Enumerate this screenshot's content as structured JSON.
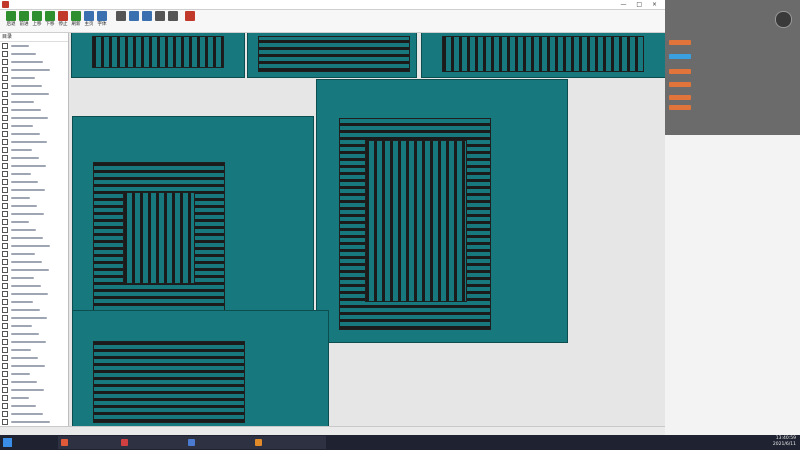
{
  "window": {
    "title": "",
    "controls": [
      "—",
      "□",
      "×"
    ]
  },
  "toolbar": {
    "buttons": [
      {
        "label": "后退",
        "icon": "back-arrow-icon",
        "color": "#2f8f2f"
      },
      {
        "label": "前进",
        "icon": "forward-arrow-icon",
        "color": "#2f8f2f"
      },
      {
        "label": "上移",
        "icon": "up-arrow-icon",
        "color": "#2f8f2f"
      },
      {
        "label": "下移",
        "icon": "down-arrow-icon",
        "color": "#2f8f2f"
      },
      {
        "label": "停止",
        "icon": "stop-icon",
        "color": "#c0392b"
      },
      {
        "label": "刷新",
        "icon": "refresh-icon",
        "color": "#2f8f2f"
      },
      {
        "label": "主页",
        "icon": "home-icon",
        "color": "#3a6fb0"
      },
      {
        "label": "字体",
        "icon": "font-icon",
        "color": "#3a6fb0"
      },
      {
        "label": "",
        "icon": "print-icon",
        "color": "#555555"
      },
      {
        "label": "",
        "icon": "bookmark-icon",
        "color": "#3a6fb0"
      },
      {
        "label": "",
        "icon": "book-icon",
        "color": "#3a6fb0"
      },
      {
        "label": "",
        "icon": "edit-icon",
        "color": "#555555"
      },
      {
        "label": "",
        "icon": "tool-icon",
        "color": "#555555"
      },
      {
        "label": "",
        "icon": "exit-icon",
        "color": "#c0392b"
      }
    ]
  },
  "sidebar": {
    "header": "目录",
    "item_count": 50
  },
  "maps": [
    {
      "title": "",
      "watermark": ""
    },
    {
      "title": "",
      "watermark": ""
    },
    {
      "title": "",
      "watermark": ""
    },
    {
      "title": "",
      "watermark": ""
    },
    {
      "title": "",
      "watermark": ""
    },
    {
      "title": "",
      "watermark": ""
    }
  ],
  "statusbar": {
    "left": "",
    "title": ""
  },
  "chat": {
    "title": "",
    "messages": [
      {
        "badge_color": "#e0743a",
        "text": ""
      },
      {
        "badge_color": "#3aa0e0",
        "text": ""
      },
      {
        "badge_color": "#e0743a",
        "text": ""
      },
      {
        "badge_color": "#e0743a",
        "text": ""
      },
      {
        "badge_color": "#e0743a",
        "text": ""
      },
      {
        "badge_color": "#e0743a",
        "text": ""
      }
    ],
    "notice": ""
  },
  "taskbar": {
    "items": [
      {
        "label": "",
        "color": "#e05a3a"
      },
      {
        "label": "",
        "color": "#d04040"
      },
      {
        "label": "",
        "color": "#4a7bd0"
      },
      {
        "label": "",
        "color": "#e08a2a"
      }
    ],
    "time": "13:40:59",
    "date": "2021/6/11"
  }
}
